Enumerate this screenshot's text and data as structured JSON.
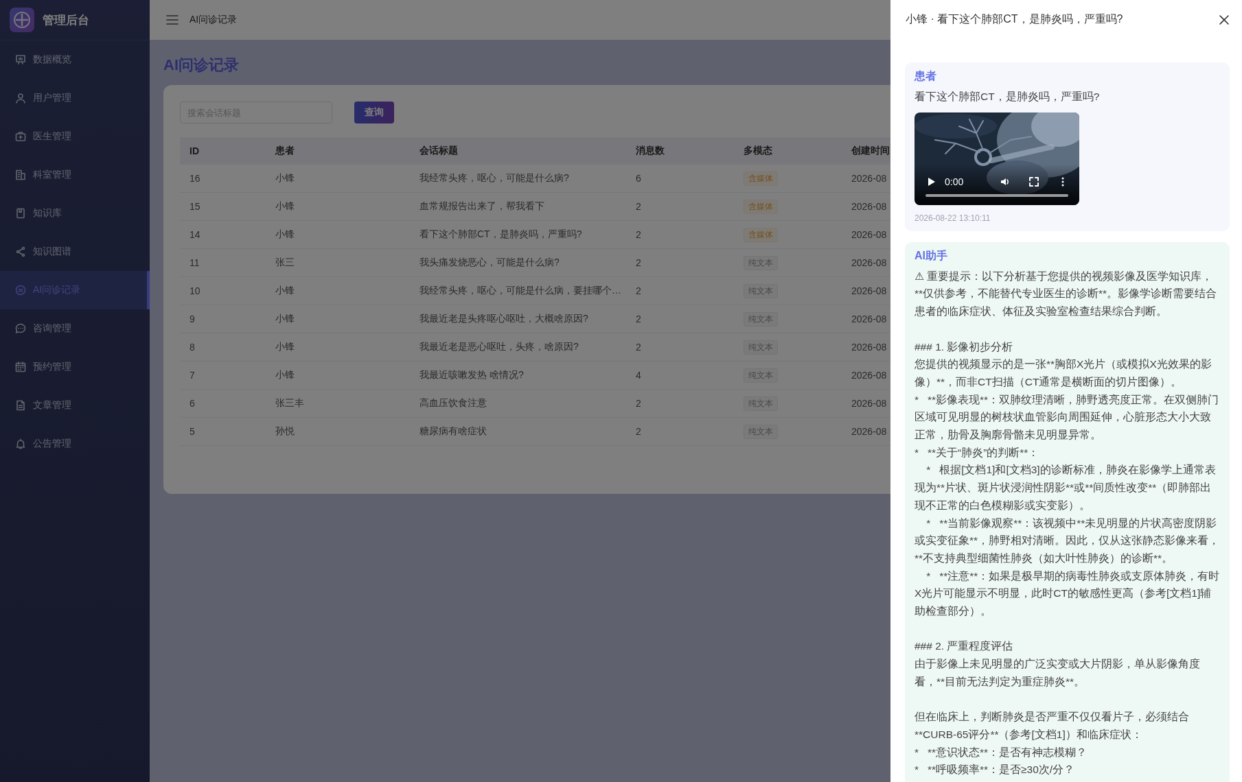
{
  "sidebar": {
    "title": "管理后台",
    "items": [
      {
        "label": "数据概览",
        "selected": false
      },
      {
        "label": "用户管理",
        "selected": false
      },
      {
        "label": "医生管理",
        "selected": false
      },
      {
        "label": "科室管理",
        "selected": false
      },
      {
        "label": "知识库",
        "selected": false
      },
      {
        "label": "知识图谱",
        "selected": false
      },
      {
        "label": "AI问诊记录",
        "selected": true
      },
      {
        "label": "咨询管理",
        "selected": false
      },
      {
        "label": "预约管理",
        "selected": false
      },
      {
        "label": "文章管理",
        "selected": false
      },
      {
        "label": "公告管理",
        "selected": false
      }
    ]
  },
  "header": {
    "breadcrumb": "AI问诊记录"
  },
  "page_title": "AI问诊记录",
  "search": {
    "placeholder": "搜索会话标题",
    "button": "查询"
  },
  "table": {
    "columns": [
      "ID",
      "患者",
      "会话标题",
      "消息数",
      "多模态",
      "创建时间"
    ],
    "rows": [
      {
        "id": "16",
        "patient": "小锋",
        "title": "我经常头疼，呕心，可能是什么病?",
        "count": "6",
        "tag": {
          "label": "含媒体",
          "kind": "media"
        },
        "created": "2026-08"
      },
      {
        "id": "15",
        "patient": "小锋",
        "title": "血常规报告出来了，帮我看下",
        "count": "2",
        "tag": {
          "label": "含媒体",
          "kind": "media"
        },
        "created": "2026-08"
      },
      {
        "id": "14",
        "patient": "小锋",
        "title": "看下这个肺部CT，是肺炎吗，严重吗?",
        "count": "2",
        "tag": {
          "label": "含媒体",
          "kind": "media"
        },
        "created": "2026-08"
      },
      {
        "id": "11",
        "patient": "张三",
        "title": "我头痛发烧恶心，可能是什么病?",
        "count": "2",
        "tag": {
          "label": "纯文本",
          "kind": "text"
        },
        "created": "2026-08"
      },
      {
        "id": "10",
        "patient": "小锋",
        "title": "我经常头疼，呕心，可能是什么病，要挂哪个…",
        "count": "2",
        "tag": {
          "label": "纯文本",
          "kind": "text"
        },
        "created": "2026-08"
      },
      {
        "id": "9",
        "patient": "小锋",
        "title": "我最近老是头疼呕心呕吐，大概啥原因?",
        "count": "2",
        "tag": {
          "label": "纯文本",
          "kind": "text"
        },
        "created": "2026-08"
      },
      {
        "id": "8",
        "patient": "小锋",
        "title": "我最近老是恶心呕吐，头疼，啥原因?",
        "count": "2",
        "tag": {
          "label": "纯文本",
          "kind": "text"
        },
        "created": "2026-08"
      },
      {
        "id": "7",
        "patient": "小锋",
        "title": "我最近咳嗽发热 啥情况?",
        "count": "4",
        "tag": {
          "label": "纯文本",
          "kind": "text"
        },
        "created": "2026-08"
      },
      {
        "id": "6",
        "patient": "张三丰",
        "title": "高血压饮食注意",
        "count": "2",
        "tag": {
          "label": "纯文本",
          "kind": "text"
        },
        "created": "2026-08"
      },
      {
        "id": "5",
        "patient": "孙悦",
        "title": "糖尿病有啥症状",
        "count": "2",
        "tag": {
          "label": "纯文本",
          "kind": "text"
        },
        "created": "2026-08"
      }
    ]
  },
  "drawer": {
    "title": "小锋 · 看下这个肺部CT，是肺炎吗，严重吗?",
    "messages": [
      {
        "kind": "user",
        "role": "患者",
        "text": "看下这个肺部CT，是肺炎吗，严重吗?",
        "video": {
          "time": "0:00"
        },
        "time": "2026-08-22 13:10:11"
      },
      {
        "kind": "assistant",
        "role": "AI助手",
        "sections": [
          {
            "lines": [
              "⚠ 重要提示：以下分析基于您提供的视频影像及医学知识库，**仅供参考，不能替代专业医生的诊断**。影像学诊断需要结合患者的临床症状、体征及实验室检查结果综合判断。"
            ]
          },
          {
            "lines": [
              "### 1. 影像初步分析",
              "您提供的视频显示的是一张**胸部X光片（或模拟X光效果的影像）**，而非CT扫描（CT通常是横断面的切片图像）。",
              "*   **影像表现**：双肺纹理清晰，肺野透亮度正常。在双侧肺门区域可见明显的树枝状血管影向周围延伸，心脏形态大小大致正常，肋骨及胸廓骨骼未见明显异常。",
              "*   **关于“肺炎”的判断**：",
              "    *   根据[文档1]和[文档3]的诊断标准，肺炎在影像学上通常表现为**片状、斑片状浸润性阴影**或**间质性改变**（即肺部出现不正常的白色模糊影或实变影）。",
              "    *   **当前影像观察**：该视频中**未见明显的片状高密度阴影或实变征象**，肺野相对清晰。因此，仅从这张静态影像来看，**不支持典型细菌性肺炎（如大叶性肺炎）的诊断**。",
              "    *   **注意**：如果是极早期的病毒性肺炎或支原体肺炎，有时X光片可能显示不明显，此时CT的敏感性更高（参考[文档1]辅助检查部分）。"
            ]
          },
          {
            "lines": [
              "### 2. 严重程度评估",
              "由于影像上未见明显的广泛实变或大片阴影，单从影像角度看，**目前无法判定为重症肺炎**。"
            ]
          },
          {
            "lines": [
              "但在临床上，判断肺炎是否严重不仅仅看片子，必须结合**CURB-65评分**（参考[文档1]）和临床症状：",
              "*   **意识状态**：是否有神志模糊？",
              "*   **呼吸频率**：是否≥30次/分？"
            ]
          }
        ]
      }
    ]
  }
}
